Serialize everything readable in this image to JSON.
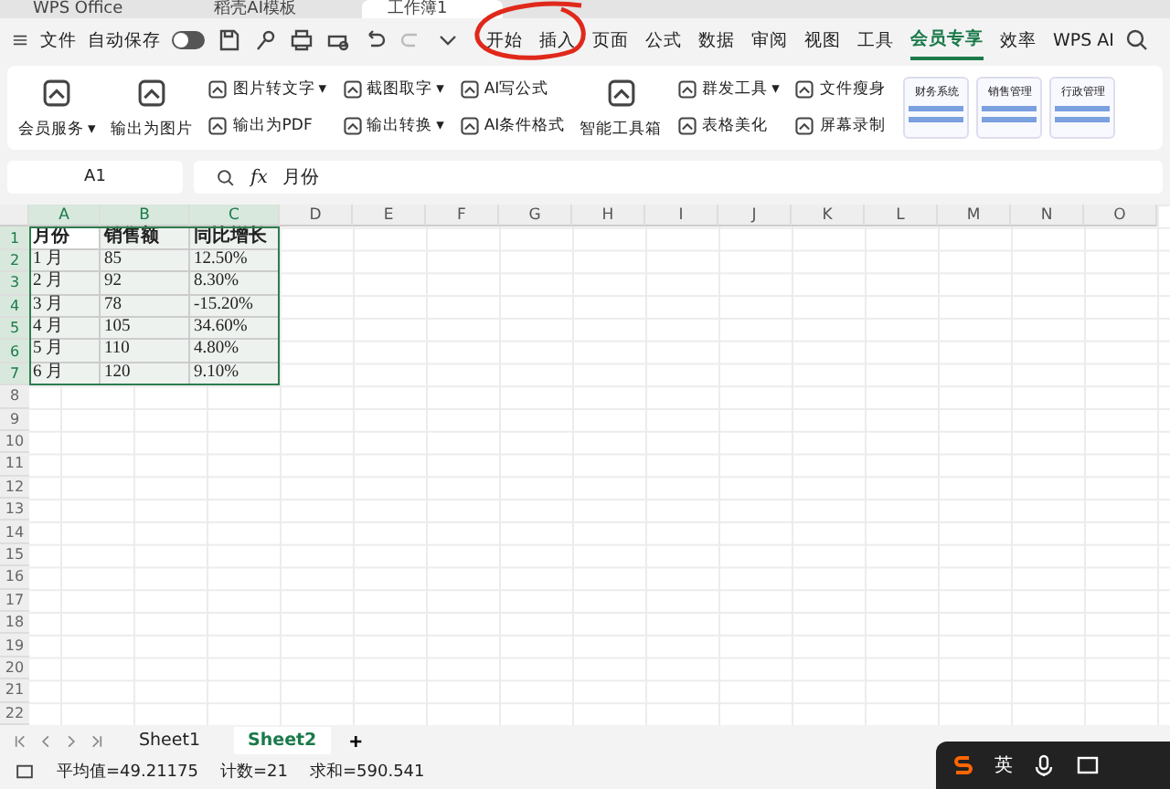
{
  "title_tabs": [
    {
      "label": "WPS Office",
      "selected": false
    },
    {
      "label": "稻壳AI模板",
      "selected": false
    },
    {
      "label": "工作簿1",
      "selected": true
    }
  ],
  "menu": {
    "file": "文件",
    "autosave": {
      "label": "自动保存",
      "on": false
    },
    "tabs": [
      {
        "label": "开始",
        "selected": false
      },
      {
        "label": "插入",
        "selected": false
      },
      {
        "label": "页面",
        "selected": false
      },
      {
        "label": "公式",
        "selected": false
      },
      {
        "label": "数据",
        "selected": false
      },
      {
        "label": "审阅",
        "selected": false
      },
      {
        "label": "视图",
        "selected": false
      },
      {
        "label": "工具",
        "selected": false
      },
      {
        "label": "会员专享",
        "selected": true
      },
      {
        "label": "效率",
        "selected": false
      },
      {
        "label": "WPS AI",
        "selected": false
      }
    ]
  },
  "ribbon": {
    "columns": [
      {
        "kind": "large",
        "items": [
          {
            "label": "会员服务",
            "dropdown": "▾"
          }
        ]
      },
      {
        "kind": "large",
        "items": [
          {
            "label": "输出为图片"
          }
        ]
      },
      {
        "kind": "stack",
        "items": [
          {
            "label": "图片转文字",
            "dropdown": "▾"
          },
          {
            "label": "输出为PDF"
          }
        ]
      },
      {
        "kind": "stack",
        "items": [
          {
            "label": "截图取字",
            "dropdown": "▾"
          },
          {
            "label": "输出转换",
            "dropdown": "▾"
          }
        ]
      },
      {
        "kind": "stack",
        "items": [
          {
            "label": "AI写公式"
          },
          {
            "label": "AI条件格式"
          }
        ]
      },
      {
        "kind": "large",
        "items": [
          {
            "label": "智能工具箱"
          }
        ]
      },
      {
        "kind": "stack",
        "items": [
          {
            "label": "群发工具",
            "dropdown": "▾"
          },
          {
            "label": "表格美化"
          }
        ]
      },
      {
        "kind": "stack",
        "items": [
          {
            "label": "文件瘦身"
          },
          {
            "label": "屏幕录制"
          }
        ]
      }
    ],
    "templates": [
      "财务系统",
      "销售管理",
      "行政管理"
    ]
  },
  "formula_bar": {
    "cell_ref": "A1",
    "fx": "fx",
    "formula": "月份"
  },
  "sheet": {
    "columns": [
      "A",
      "B",
      "C",
      "D",
      "E",
      "F",
      "G",
      "H",
      "I",
      "J",
      "K",
      "L",
      "M",
      "N",
      "O"
    ],
    "row_numbers": [
      "1",
      "2",
      "3",
      "4",
      "5",
      "6",
      "7",
      "8",
      "9",
      "10",
      "11",
      "12",
      "13",
      "14",
      "15",
      "16",
      "17",
      "18",
      "19",
      "20",
      "21",
      "22"
    ],
    "cells": [
      [
        "月份",
        "销售额",
        "同比增长"
      ],
      [
        "1 月",
        "85",
        "12.50%"
      ],
      [
        "2 月",
        "92",
        "8.30%"
      ],
      [
        "3 月",
        "78",
        "-15.20%"
      ],
      [
        "4 月",
        "105",
        "34.60%"
      ],
      [
        "5 月",
        "110",
        "4.80%"
      ],
      [
        "6 月",
        "120",
        "9.10%"
      ]
    ]
  },
  "sheet_tabs": [
    {
      "label": "Sheet1",
      "selected": false
    },
    {
      "label": "Sheet2",
      "selected": true
    }
  ],
  "add_sheet": "+",
  "status": [
    "平均值=49.21175",
    "计数=21",
    "求和=590.541"
  ],
  "ime": {
    "label": "英"
  }
}
